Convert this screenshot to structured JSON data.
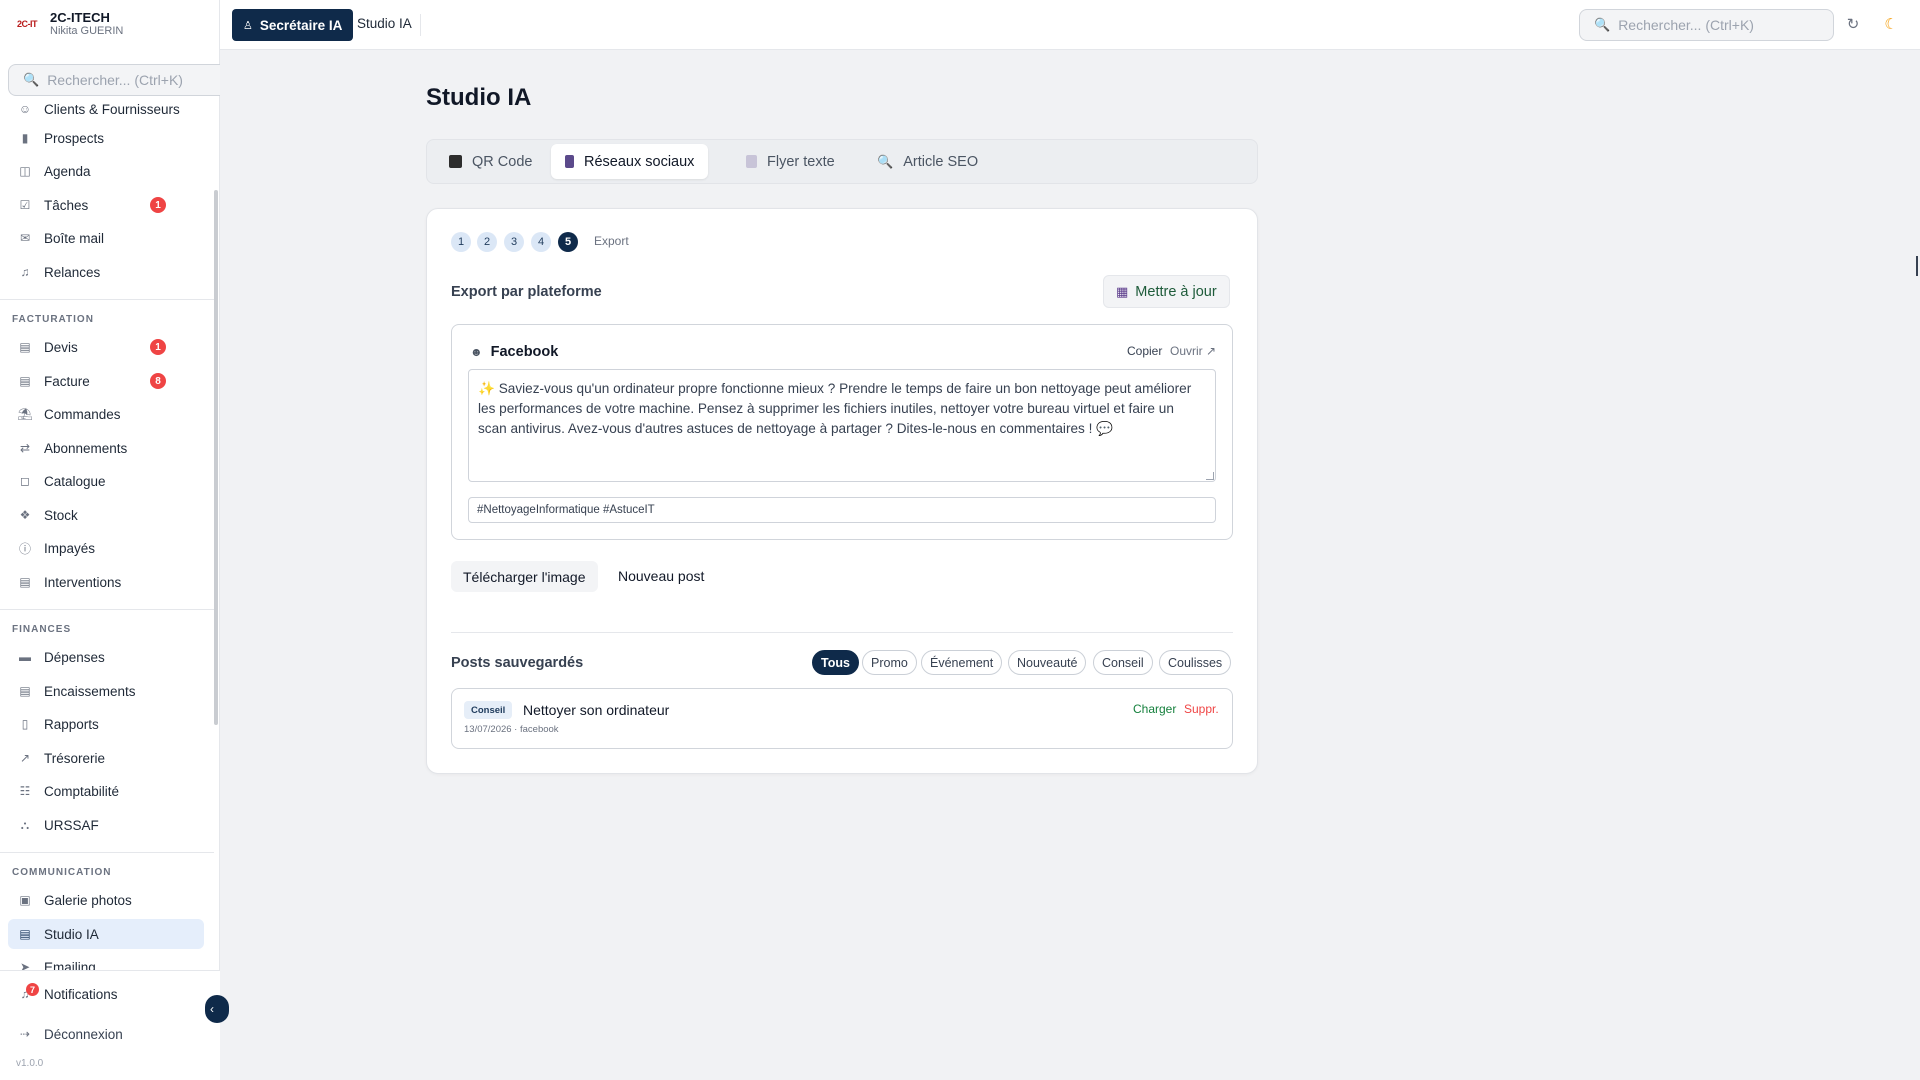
{
  "brand": {
    "logo_text": "2C-IT",
    "title": "2C-ITECH",
    "user": "Nikita GUERIN"
  },
  "sidebar": {
    "search_placeholder": "Rechercher... (Ctrl+K)",
    "items_top": [
      {
        "label": "Clients & Fournisseurs",
        "icon": "users-icon"
      },
      {
        "label": "Prospects",
        "icon": "kanban-icon"
      },
      {
        "label": "Agenda",
        "icon": "calendar-icon"
      },
      {
        "label": "Tâches",
        "icon": "checkbox-icon",
        "badge": "1"
      },
      {
        "label": "Boîte mail",
        "icon": "mail-icon"
      },
      {
        "label": "Relances",
        "icon": "bell-icon"
      }
    ],
    "section_billing": "FACTURATION",
    "items_billing": [
      {
        "label": "Devis",
        "icon": "document-icon",
        "badge": "1"
      },
      {
        "label": "Facture",
        "icon": "invoice-icon",
        "badge": "8"
      },
      {
        "label": "Commandes",
        "icon": "cart-icon"
      },
      {
        "label": "Abonnements",
        "icon": "repeat-icon"
      },
      {
        "label": "Catalogue",
        "icon": "box-icon"
      },
      {
        "label": "Stock",
        "icon": "boxes-icon"
      },
      {
        "label": "Impayés",
        "icon": "alert-circle-icon"
      },
      {
        "label": "Interventions",
        "icon": "clipboard-icon"
      }
    ],
    "section_finances": "FINANCES",
    "items_finances": [
      {
        "label": "Dépenses",
        "icon": "credit-card-icon"
      },
      {
        "label": "Encaissements",
        "icon": "banknote-icon"
      },
      {
        "label": "Rapports",
        "icon": "bar-chart-icon"
      },
      {
        "label": "Trésorerie",
        "icon": "trending-up-icon"
      },
      {
        "label": "Comptabilité",
        "icon": "book-icon"
      },
      {
        "label": "URSSAF",
        "icon": "bank-icon"
      }
    ],
    "section_communication": "COMMUNICATION",
    "items_communication": [
      {
        "label": "Galerie photos",
        "icon": "image-icon"
      },
      {
        "label": "Studio IA",
        "icon": "document-icon",
        "active": true
      },
      {
        "label": "Emailing",
        "icon": "send-icon"
      }
    ],
    "notifications_label": "Notifications",
    "notifications_badge": "7",
    "logout_label": "Déconnexion",
    "version": "v1.0.0"
  },
  "topbar": {
    "active_label": "Secrétaire IA",
    "crumb": "Studio IA",
    "search_placeholder": "Rechercher... (Ctrl+K)"
  },
  "main": {
    "title": "Studio IA",
    "tabs": [
      {
        "label": "QR Code",
        "icon_color": "#2d2d2d"
      },
      {
        "label": "Réseaux sociaux",
        "icon_color": "#5b4a8b",
        "active": true
      },
      {
        "label": "Flyer texte",
        "icon_color": "#c8c4d8"
      },
      {
        "label": "Article SEO",
        "icon_color": "#3b82f6"
      }
    ],
    "steps": [
      "1",
      "2",
      "3",
      "4",
      "5"
    ],
    "active_step": "5",
    "step_label": "Export",
    "export_heading": "Export par plateforme",
    "update_button": "Mettre à jour",
    "platform": {
      "name": "Facebook",
      "copy": "Copier",
      "open": "Ouvrir ↗",
      "text": "✨ Saviez-vous qu'un ordinateur propre fonctionne mieux ? Prendre le temps de faire un bon nettoyage peut améliorer les performances de votre machine. Pensez à supprimer les fichiers inutiles, nettoyer votre bureau virtuel et faire un scan antivirus. Avez-vous d'autres astuces de nettoyage à partager ? Dites-le-nous en commentaires ! 💬",
      "hashtags": "#NettoyageInformatique #AstuceIT"
    },
    "download_button": "Télécharger l'image",
    "new_post_button": "Nouveau post",
    "saved_heading": "Posts sauvegardés",
    "filters": [
      "Tous",
      "Promo",
      "Événement",
      "Nouveauté",
      "Conseil",
      "Coulisses"
    ],
    "active_filter": "Tous",
    "saved_posts": [
      {
        "tag": "Conseil",
        "title": "Nettoyer son ordinateur",
        "meta": "13/07/2026 · facebook",
        "load": "Charger",
        "delete": "Suppr."
      }
    ]
  }
}
